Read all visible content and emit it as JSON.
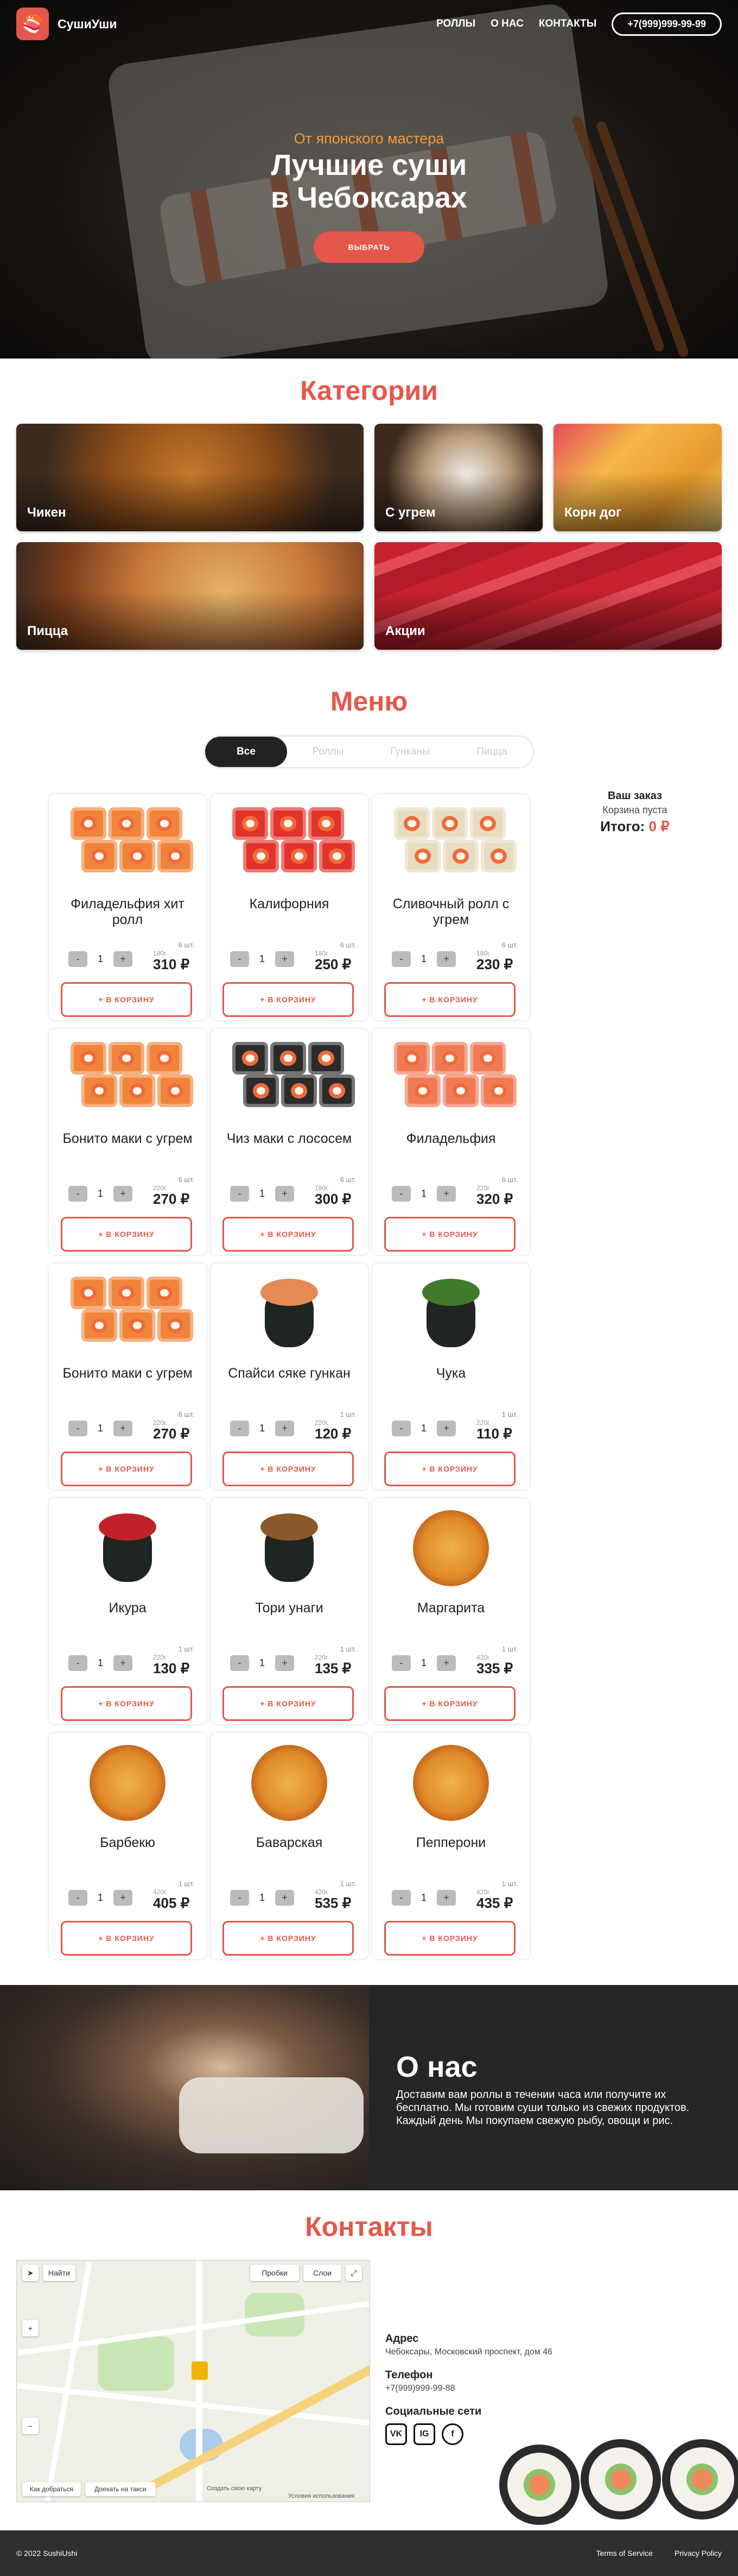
{
  "header": {
    "brand": "СушиУши",
    "logo_icon": "sushi-logo-icon",
    "nav": [
      "РОЛЛЫ",
      "О НАС",
      "КОНТАКТЫ"
    ],
    "phone": "+7(999)999-99-99"
  },
  "hero": {
    "subtitle": "От японского мастера",
    "title_line1": "Лучшие суши",
    "title_line2": "в Чебоксарах",
    "button": "ВЫБРАТЬ"
  },
  "categories": {
    "title": "Категории",
    "items": [
      "Чикен",
      "С угрем",
      "Корн дог",
      "Пицца",
      "Акции"
    ]
  },
  "menu": {
    "title": "Меню",
    "tabs": [
      "Все",
      "Роллы",
      "Гунканы",
      "Пицца"
    ],
    "add_label": "+ В КОРЗИНУ",
    "qty": "1",
    "minus": "-",
    "plus": "+",
    "items": [
      {
        "name": "Филадельфия хит ролл",
        "count": "6 шт.",
        "weight": "180г.",
        "price": "310 ₽"
      },
      {
        "name": "Калифорния",
        "count": "6 шт.",
        "weight": "180г.",
        "price": "250 ₽"
      },
      {
        "name": "Сливочный ролл с угрем",
        "count": "6 шт.",
        "weight": "180г.",
        "price": "230 ₽"
      },
      {
        "name": "Бонито маки с угрем",
        "count": "6 шт.",
        "weight": "220г.",
        "price": "270 ₽"
      },
      {
        "name": "Чиз маки с лососем",
        "count": "6 шт.",
        "weight": "180г.",
        "price": "300 ₽"
      },
      {
        "name": "Филадельфия",
        "count": "6 шт.",
        "weight": "220г.",
        "price": "320 ₽"
      },
      {
        "name": "Бонито маки с угрем",
        "count": "6 шт.",
        "weight": "220г.",
        "price": "270 ₽"
      },
      {
        "name": "Спайси сяке гункан",
        "count": "1 шт.",
        "weight": "220г.",
        "price": "120 ₽"
      },
      {
        "name": "Чука",
        "count": "1 шт.",
        "weight": "220г.",
        "price": "110 ₽"
      },
      {
        "name": "Икура",
        "count": "1 шт.",
        "weight": "220г.",
        "price": "130 ₽"
      },
      {
        "name": "Тори унаги",
        "count": "1 шт.",
        "weight": "220г.",
        "price": "135 ₽"
      },
      {
        "name": "Маргарита",
        "count": "1 шт.",
        "weight": "420г.",
        "price": "335 ₽"
      },
      {
        "name": "Барбекю",
        "count": "1 шт.",
        "weight": "420г.",
        "price": "405 ₽"
      },
      {
        "name": "Баварская",
        "count": "1 шт.",
        "weight": "420г.",
        "price": "535 ₽"
      },
      {
        "name": "Пепперони",
        "count": "1 шт.",
        "weight": "420г.",
        "price": "435 ₽"
      }
    ]
  },
  "order": {
    "title": "Ваш заказ",
    "empty": "Корзина пуста",
    "total_label": "Итого:",
    "total_value": "0 ₽"
  },
  "about": {
    "title": "О нас",
    "text": "Доставим вам роллы в течении часа или получите их бесплатно. Мы готовим суши только из свежих продуктов. Каждый день Мы покупаем свежую рыбу, овощи и рис."
  },
  "contacts": {
    "title": "Контакты",
    "address_label": "Адрес",
    "address": "Чебоксары, Московский проспект, дом 46",
    "phone_label": "Телефон",
    "phone": "+7(999)999-99-88",
    "social_label": "Социальные сети",
    "socials": [
      "VK",
      "IG",
      "f"
    ]
  },
  "map": {
    "find": "Найти",
    "traffic": "Пробки",
    "layers": "Слои",
    "route": "Как добраться",
    "taxi": "Доехать на такси",
    "create": "Создать свою карту",
    "terms": "Условия использования"
  },
  "footer": {
    "copyright": "© 2022 SushiUshi",
    "terms": "Terms of Service",
    "privacy": "Privacy Policy"
  },
  "colors": {
    "accent": "#e5574a",
    "dark": "#262626"
  }
}
